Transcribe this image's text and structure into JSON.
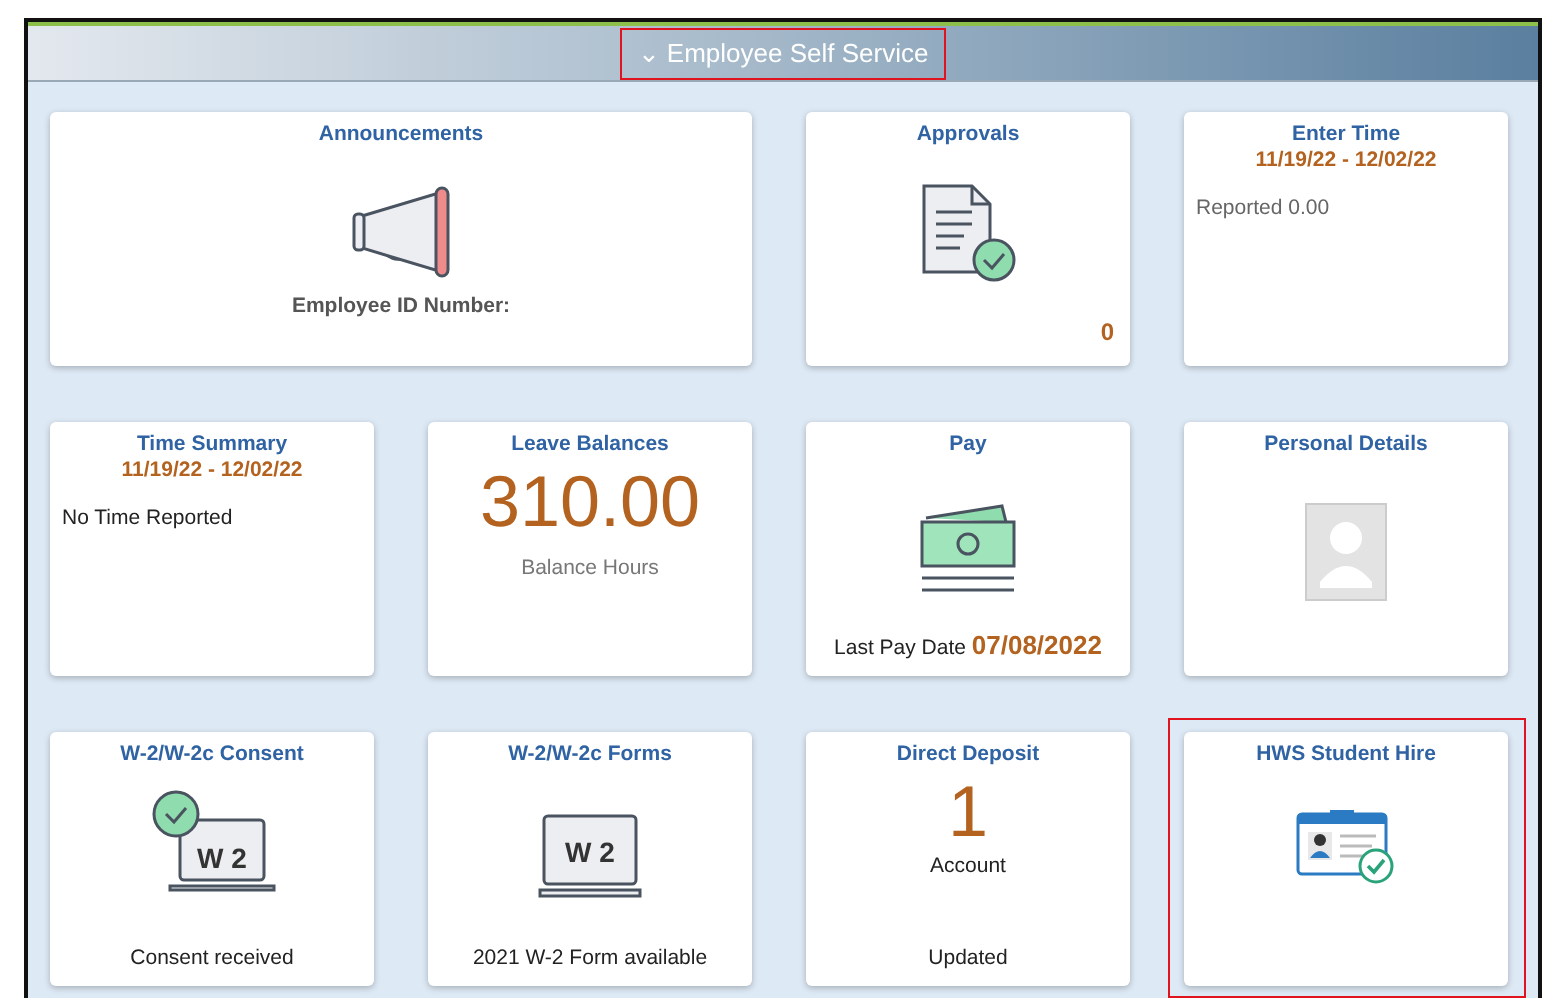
{
  "header": {
    "title": "Employee Self Service",
    "toggle": "⌄",
    "highlighted": true
  },
  "tiles": [
    {
      "kind": "announcements",
      "title": "Announcements",
      "caption": "Employee ID Number:",
      "highlighted": false
    },
    {
      "kind": "approvals",
      "title": "Approvals",
      "count": "0",
      "highlighted": false
    },
    {
      "kind": "time",
      "title": "Enter Time",
      "date": "11/19/22 - 12/02/22",
      "note": "Reported 0.00",
      "highlighted": false
    },
    {
      "kind": "time",
      "title": "Time Summary",
      "date": "11/19/22 - 12/02/22",
      "note": "No Time Reported",
      "highlighted": false
    },
    {
      "kind": "number",
      "title": "Leave Balances",
      "big": "310.00",
      "caption": "Balance Hours",
      "highlighted": false
    },
    {
      "kind": "pay",
      "title": "Pay",
      "footer": "Last Pay Date",
      "footer_value": "07/08/2022",
      "highlighted": false
    },
    {
      "kind": "profile",
      "title": "Personal Details",
      "highlighted": false
    },
    {
      "kind": "w2_consent",
      "title": "W-2/W-2c Consent",
      "icon_label": "W 2",
      "footer": "Consent received",
      "highlighted": false
    },
    {
      "kind": "w2_forms",
      "title": "W-2/W-2c Forms",
      "icon_label": "W 2",
      "footer": "2021 W-2 Form available",
      "highlighted": false
    },
    {
      "kind": "number",
      "title": "Direct Deposit",
      "big": "1",
      "caption": "Account",
      "footer": "Updated",
      "highlighted": false
    },
    {
      "kind": "hire",
      "title": "HWS Student Hire",
      "highlighted": true
    }
  ]
}
